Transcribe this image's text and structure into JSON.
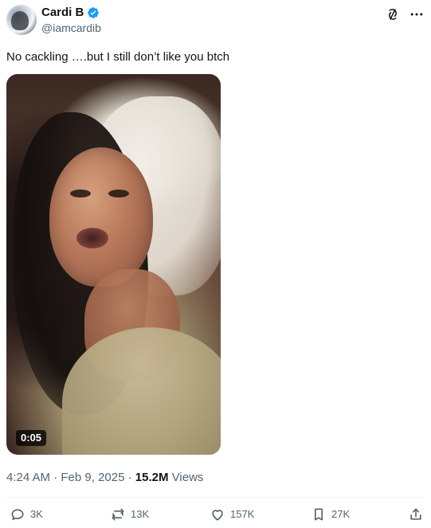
{
  "post": {
    "author": {
      "display_name": "Cardi B",
      "handle": "@iamcardib",
      "verified": true
    },
    "text": "No cackling ….but I still don’t like you btch",
    "media": {
      "type": "video",
      "duration": "0:05"
    },
    "meta": {
      "time": "4:24 AM",
      "separator": "·",
      "date": "Feb 9, 2025",
      "views_count": "15.2M",
      "views_label": "Views"
    },
    "actions": {
      "reply": "3K",
      "repost": "13K",
      "like": "157K",
      "bookmark": "27K"
    }
  },
  "colors": {
    "text_primary": "#0f1419",
    "text_secondary": "#536471",
    "verified_blue": "#1d9bf0",
    "divider": "#eff3f4"
  },
  "icons": {
    "verified": "verified-badge-icon",
    "grok": "grok-icon",
    "more": "more-icon",
    "reply": "reply-icon",
    "repost": "repost-icon",
    "like": "heart-icon",
    "bookmark": "bookmark-icon",
    "share": "share-icon"
  }
}
